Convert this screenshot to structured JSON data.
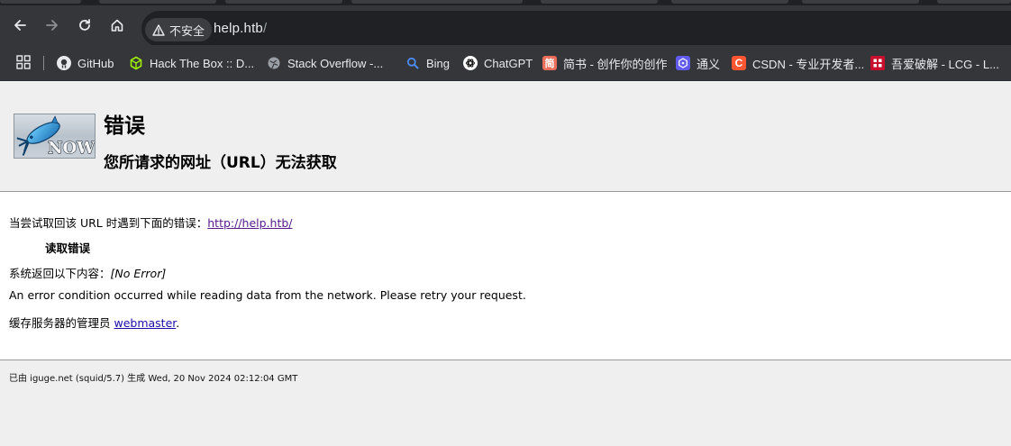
{
  "browser": {
    "security_label": "不安全",
    "url_host": "help.htb",
    "url_path": "/"
  },
  "bookmarks": [
    {
      "label": "GitHub",
      "icon": "github-icon"
    },
    {
      "label": "Hack The Box :: D...",
      "icon": "htb-cube-icon"
    },
    {
      "label": "Stack Overflow -...",
      "icon": "globe-icon"
    },
    {
      "label": "Bing",
      "icon": "search-icon"
    },
    {
      "label": "ChatGPT",
      "icon": "chatgpt-icon"
    },
    {
      "label": "简书 - 创作你的创作",
      "icon": "jianshu-icon",
      "glyph": "简"
    },
    {
      "label": "通义",
      "icon": "tongyi-icon"
    },
    {
      "label": "CSDN - 专业开发者...",
      "icon": "csdn-icon",
      "glyph": "C"
    },
    {
      "label": "吾爱破解 - LCG - L...",
      "icon": "52pojie-icon"
    }
  ],
  "error_page": {
    "title": "错误",
    "subtitle": "您所请求的网址（URL）无法获取",
    "attempt_prefix": "当尝试取回该 URL 时遇到下面的错误：",
    "attempt_url": "http://help.htb/",
    "error_name": "读取错误",
    "system_prefix": "系统返回以下内容：",
    "system_message": "[No Error]",
    "description": "An error condition occurred while reading data from the network. Please retry your request.",
    "admin_prefix": "缓存服务器的管理员 ",
    "admin_link": "webmaster",
    "admin_suffix": ".",
    "footer": "已由 iguge.net (squid/5.7) 生成 Wed, 20 Nov 2024 02:12:04 GMT"
  },
  "colors": {
    "chrome_bg": "#35363a",
    "omnibox_bg": "#202124",
    "link": "#1a0dab",
    "visited_link": "#551a8b"
  }
}
